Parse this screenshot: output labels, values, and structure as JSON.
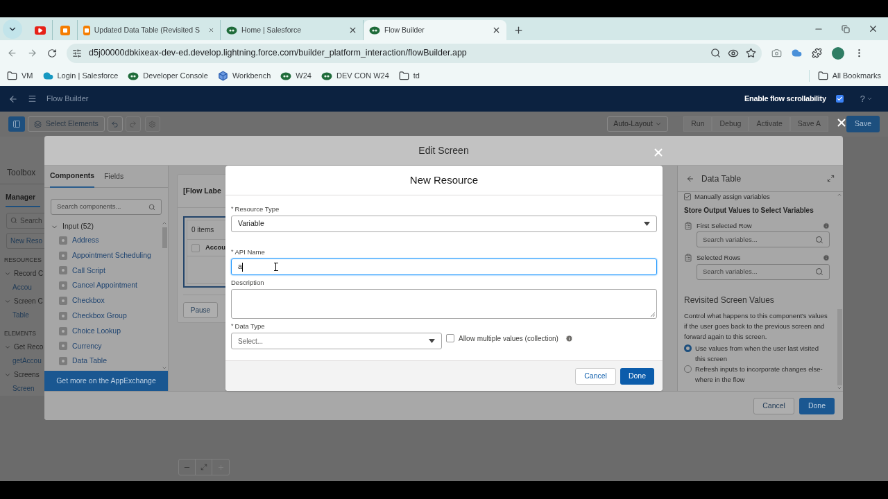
{
  "browser": {
    "tabs": [
      {
        "kind": "pinned",
        "selected": false
      },
      {
        "kind": "pinned",
        "selected": false
      },
      {
        "kind": "titled",
        "title": "Updated Data Table (Revisited S",
        "selected": false
      },
      {
        "kind": "titled",
        "title": "Home | Salesforce",
        "selected": false
      },
      {
        "kind": "titled",
        "title": "Flow Builder",
        "selected": true
      }
    ],
    "url": "d5j00000dbkixeax-dev-ed.develop.lightning.force.com/builder_platform_interaction/flowBuilder.app",
    "bookmarks": [
      "VM",
      "Login | Salesforce",
      "Developer Console",
      "Workbench",
      "W24",
      "DEV CON W24",
      "td"
    ],
    "all_bookmarks": "All Bookmarks"
  },
  "header": {
    "title": "Flow Builder",
    "scroll_toggle": {
      "label": "Enable flow scrollability",
      "checked": true
    },
    "help": "?"
  },
  "toolbar": {
    "select_elements": "Select Elements",
    "layout": "Auto-Layout",
    "buttons": [
      {
        "label": "Run",
        "disabled": true
      },
      {
        "label": "Debug",
        "disabled": true
      },
      {
        "label": "Activate",
        "disabled": true
      },
      {
        "label": "Save A",
        "disabled": true
      }
    ],
    "save": "Save"
  },
  "sidebar": {
    "title": "Toolbox",
    "tab": "Manager",
    "search": "Search",
    "new_button": "New Reso",
    "sections": [
      {
        "heading": "RESOURCES",
        "items": [
          {
            "label": "Record C",
            "expanded": true,
            "children": [
              {
                "label": "Accou"
              }
            ]
          },
          {
            "label": "Screen C",
            "expanded": true,
            "children": [
              {
                "label": "Table"
              }
            ]
          }
        ]
      },
      {
        "heading": "ELEMENTS",
        "items": [
          {
            "label": "Get Reco",
            "expanded": true,
            "children": [
              {
                "label": "getAccou"
              }
            ]
          },
          {
            "label": "Screens",
            "expanded": true,
            "children": [
              {
                "label": "Screen"
              }
            ]
          }
        ]
      }
    ]
  },
  "edit_screen": {
    "title": "Edit Screen",
    "palette": {
      "tabs": [
        {
          "label": "Components",
          "selected": true
        },
        {
          "label": "Fields",
          "selected": false
        }
      ],
      "search_placeholder": "Search components...",
      "group": {
        "label": "Input (52)",
        "expanded": true,
        "items": [
          "Address",
          "Appointment Scheduling",
          "Call Script",
          "Cancel Appointment",
          "Checkbox",
          "Checkbox Group",
          "Choice Lookup",
          "Currency",
          "Data Table"
        ]
      },
      "appexchange": "Get more on the AppExchange"
    },
    "canvas": {
      "label": "[Flow Labe",
      "count": "0 items",
      "row_checked": false,
      "column": "Accou",
      "pause": "Pause"
    },
    "properties": {
      "title": "Data Table",
      "manual": {
        "label": "Manually assign variables",
        "checked": true
      },
      "output_heading": "Store Output Values to Select Variables",
      "outputs": [
        {
          "label": "First Selected Row",
          "placeholder": "Search variables..."
        },
        {
          "label": "Selected Rows",
          "placeholder": "Search variables..."
        }
      ],
      "revisit_heading": "Revisited Screen Values",
      "revisit_text": "Control what happens to this component's values if the user goes back to the previous screen and forward again to this screen.",
      "options": [
        {
          "label": "Use values from when the user last visited this screen",
          "selected": true
        },
        {
          "label": "Refresh inputs to incorporate changes else-where in the flow",
          "selected": false
        }
      ]
    },
    "cancel": "Cancel",
    "done": "Done"
  },
  "new_resource": {
    "title": "New Resource",
    "fields": [
      {
        "kind": "select",
        "required_mark": "*",
        "label": "Resource Type",
        "value": "Variable"
      },
      {
        "kind": "text",
        "required_mark": "*",
        "label": "API Name",
        "value": "a",
        "focused": true
      },
      {
        "kind": "textarea",
        "label": "Description"
      }
    ],
    "data_type": {
      "required_mark": "*",
      "label": "Data Type",
      "placeholder": "Select..."
    },
    "collection": {
      "label": "Allow multiple values (collection)",
      "checked": false
    },
    "cancel": "Cancel",
    "done": "Done"
  }
}
